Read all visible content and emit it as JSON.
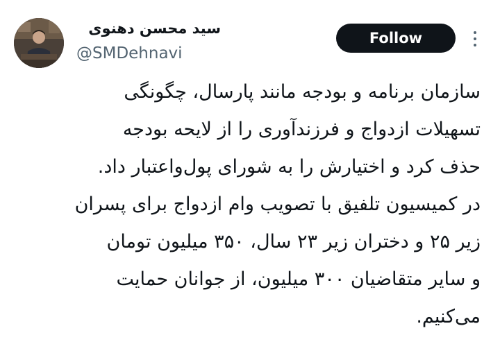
{
  "author": {
    "display_name": "سید محسن دهنوی",
    "handle": "@SMDehnavi",
    "avatar_icon": "profile-photo"
  },
  "actions": {
    "follow_label": "Follow",
    "more_icon": "more-vertical-icon"
  },
  "tweet": {
    "lines": [
      "سازمان برنامه و بودجه مانند پارسال، چگونگی",
      "تسهیلات ازدواج و فرزندآوری را از لایحه بودجه",
      "حذف کرد و اختیارش را به شورای پول‌واعتبار داد.",
      "در کمیسیون تلفیق با تصویب وام ازدواج برای پسران",
      "زیر ۲۵ و دختران زیر ۲۳ سال، ۳۵۰ میلیون تومان",
      "و سایر متقاضیان ۳۰۰ میلیون، از جوانان حمایت",
      "می‌کنیم."
    ]
  },
  "colors": {
    "primary_text": "#0f1419",
    "secondary_text": "#536471",
    "follow_bg": "#0f1419",
    "background": "#ffffff"
  }
}
